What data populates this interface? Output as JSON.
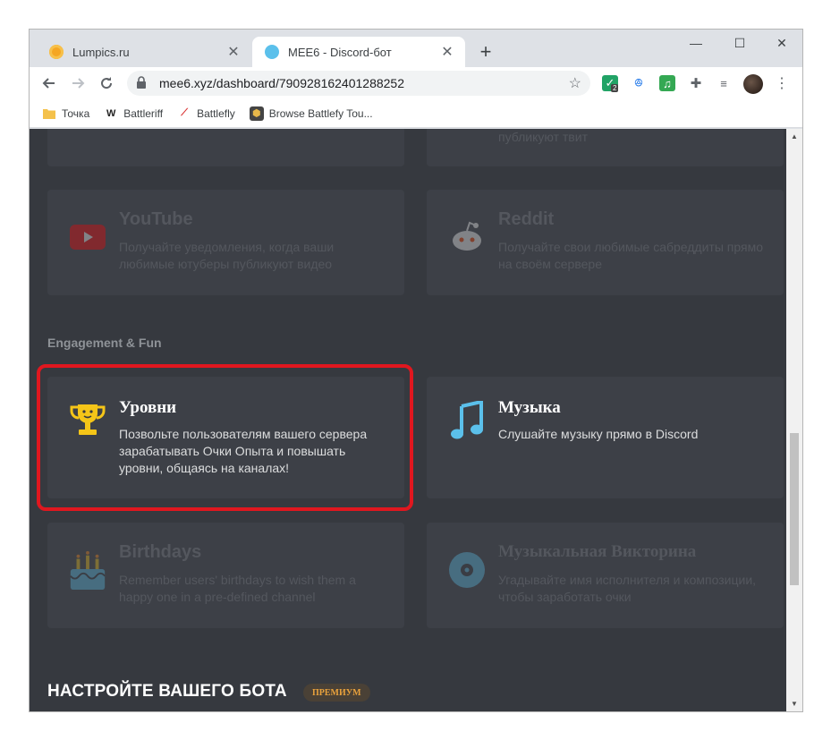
{
  "tabs": [
    {
      "title": "Lumpics.ru",
      "close": "✕"
    },
    {
      "title": "MEE6 - Discord-бот",
      "close": "✕"
    }
  ],
  "new_tab": "+",
  "window_controls": {
    "minimize": "—",
    "maximize": "☐",
    "close": "✕"
  },
  "toolbar": {
    "url": "mee6.xyz/dashboard/790928162401288252",
    "extension_badge": "2"
  },
  "bookmarks": [
    {
      "label": "Точка",
      "icon": "folder-icon"
    },
    {
      "label": "Battleriff",
      "icon": "battleriff-icon"
    },
    {
      "label": "Battlefly",
      "icon": "battlefly-icon"
    },
    {
      "label": "Browse Battlefy Tou...",
      "icon": "battlefy-icon"
    }
  ],
  "top_partial": {
    "desc": "публикуют твит"
  },
  "cards": {
    "youtube": {
      "title": "YouTube",
      "desc": "Получайте уведомления, когда ваши любимые ютуберы публикуют видео"
    },
    "reddit": {
      "title": "Reddit",
      "desc": "Получайте свои любимые сабреддиты прямо на своём сервере"
    },
    "levels": {
      "title": "Уровни",
      "desc": "Позвольте пользователям вашего сервера зарабатывать Очки Опыта и повышать уровни, общаясь на каналах!"
    },
    "music": {
      "title": "Музыка",
      "desc": "Слушайте музыку прямо в Discord"
    },
    "birthdays": {
      "title": "Birthdays",
      "desc": "Remember users' birthdays to wish them a happy one in a pre-defined channel"
    },
    "quiz": {
      "title": "Музыкальная Викторина",
      "desc": "Угадывайте имя исполнителя и композиции, чтобы заработать очки"
    }
  },
  "section_label": "Engagement & Fun",
  "footer": {
    "title": "НАСТРОЙТЕ ВАШЕГО БОТА",
    "badge": "ПРЕМИУМ"
  },
  "colors": {
    "accent_red": "#e0171f",
    "background": "#36393f",
    "card": "#3d4047",
    "premium": "#e8a13c"
  }
}
